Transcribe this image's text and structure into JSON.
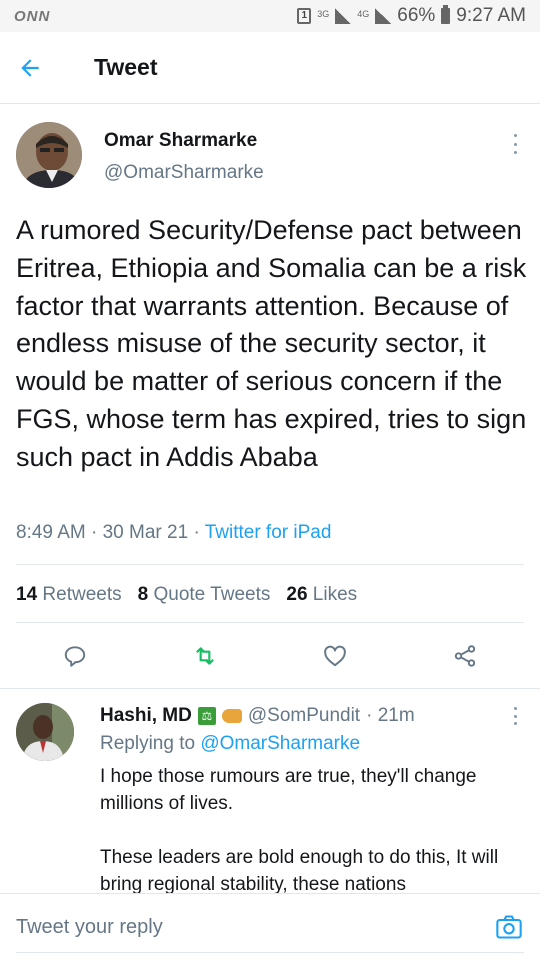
{
  "status_bar": {
    "carrier": "ONN",
    "network_3g": "3G",
    "network_4g": "4G",
    "battery_percent": "66%",
    "time": "9:27 AM"
  },
  "header": {
    "title": "Tweet"
  },
  "tweet": {
    "author_name": "Omar Sharmarke",
    "author_handle": "@OmarSharmarke",
    "text": "A rumored Security/Defense pact between Eritrea, Ethiopia and Somalia can be a risk factor that warrants attention. Because of endless misuse of the security sector, it would  be matter of serious concern if the FGS, whose term has expired, tries to sign such  pact in Addis Ababa",
    "time": "8:49 AM",
    "date": "30 Mar 21",
    "source": "Twitter for iPad",
    "separator": "·",
    "retweets_count": "14",
    "retweets_label": "Retweets",
    "quotes_count": "8",
    "quotes_label": "Quote Tweets",
    "likes_count": "26",
    "likes_label": "Likes"
  },
  "reply": {
    "author_name": "Hashi, MD",
    "author_handle": "@SomPundit",
    "age": "· 21m",
    "replying_prefix": "Replying to",
    "replying_to": "@OmarSharmarke",
    "text": "I hope those rumours are true, they'll change millions of lives.\n\nThese leaders are bold enough to do this, It will bring regional stability, these nations"
  },
  "compose": {
    "placeholder": "Tweet your reply"
  },
  "colors": {
    "accent": "#1da1f2",
    "retweet": "#17bf63",
    "muted": "#657786"
  },
  "icons": [
    "back-arrow-icon",
    "more-vertical-icon",
    "reply-icon",
    "retweet-icon",
    "like-icon",
    "share-icon",
    "camera-icon"
  ]
}
